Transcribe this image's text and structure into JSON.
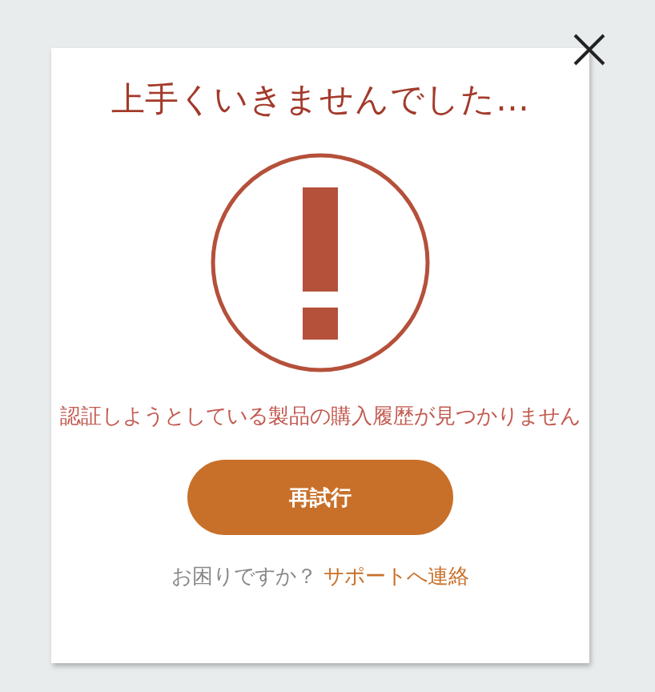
{
  "dialog": {
    "title": "上手くいきませんでした…",
    "message": "認証しようとしている製品の購入履歴が見つかりません",
    "retry_button": "再試行",
    "help_text": "お困りですか？",
    "help_link": "サポートへ連絡"
  }
}
